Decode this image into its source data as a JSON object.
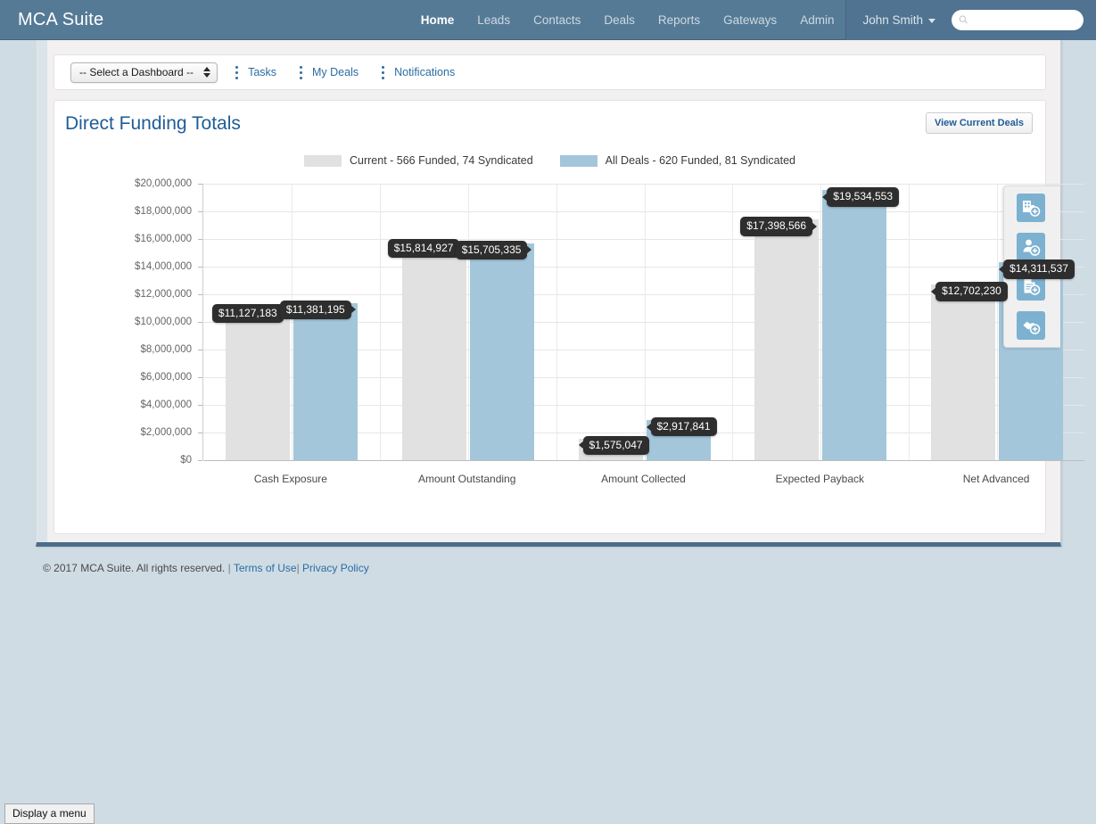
{
  "navbar": {
    "brand": "MCA Suite",
    "links": [
      {
        "label": "Home",
        "active": true
      },
      {
        "label": "Leads",
        "active": false
      },
      {
        "label": "Contacts",
        "active": false
      },
      {
        "label": "Deals",
        "active": false
      },
      {
        "label": "Reports",
        "active": false
      },
      {
        "label": "Gateways",
        "active": false
      },
      {
        "label": "Admin",
        "active": false
      }
    ],
    "user": "John Smith",
    "search_placeholder": "",
    "search_value": "",
    "bg_color": "#557a96"
  },
  "toolbar": {
    "dashboard_select": "-- Select a Dashboard --",
    "links": [
      {
        "label": "Tasks"
      },
      {
        "label": "My Deals"
      },
      {
        "label": "Notifications"
      }
    ]
  },
  "card": {
    "title": "Direct Funding Totals",
    "view_deals_label": "View Current Deals"
  },
  "chart_data": {
    "type": "bar",
    "title": "Direct Funding Totals",
    "xlabel": "",
    "ylabel": "",
    "ylim": [
      0,
      20000000
    ],
    "ytick_values": [
      0,
      2000000,
      4000000,
      6000000,
      8000000,
      10000000,
      12000000,
      14000000,
      16000000,
      18000000,
      20000000
    ],
    "ytick_labels": [
      "$0",
      "$2,000,000",
      "$4,000,000",
      "$6,000,000",
      "$8,000,000",
      "$10,000,000",
      "$12,000,000",
      "$14,000,000",
      "$16,000,000",
      "$18,000,000",
      "$20,000,000"
    ],
    "grid": true,
    "legend_position": "top-center",
    "categories": [
      "Cash Exposure",
      "Amount Outstanding",
      "Amount Collected",
      "Expected Payback",
      "Net Advanced"
    ],
    "series": [
      {
        "name": "Current - 566 Funded, 74 Syndicated",
        "color": "#e1e1e1",
        "values": [
          11127183,
          15814927,
          1575047,
          17398566,
          12702230
        ],
        "labels": [
          "$11,127,183",
          "$15,814,927",
          "$1,575,047",
          "$17,398,566",
          "$12,702,230"
        ],
        "label_sides": [
          "right",
          "right",
          "left",
          "right",
          "left"
        ]
      },
      {
        "name": "All Deals - 620 Funded, 81 Syndicated",
        "color": "#a3c6da",
        "values": [
          11381195,
          15705335,
          2917841,
          19534553,
          14311537
        ],
        "labels": [
          "$11,381,195",
          "$15,705,335",
          "$2,917,841",
          "$19,534,553",
          "$14,311,537"
        ],
        "label_sides": [
          "right",
          "right",
          "left",
          "left",
          "left"
        ]
      }
    ]
  },
  "action_rail": {
    "buttons": [
      {
        "name": "add-company-icon",
        "title": "Add Company"
      },
      {
        "name": "add-contact-icon",
        "title": "Add Contact"
      },
      {
        "name": "add-document-icon",
        "title": "Add Document"
      },
      {
        "name": "add-deal-icon",
        "title": "Add Deal"
      }
    ]
  },
  "footer": {
    "copyright": "© 2017 MCA Suite. All rights reserved.",
    "separator1": "|",
    "terms": "Terms of Use",
    "separator2": "|",
    "privacy": "Privacy Policy"
  },
  "status_tip": "Display a menu"
}
